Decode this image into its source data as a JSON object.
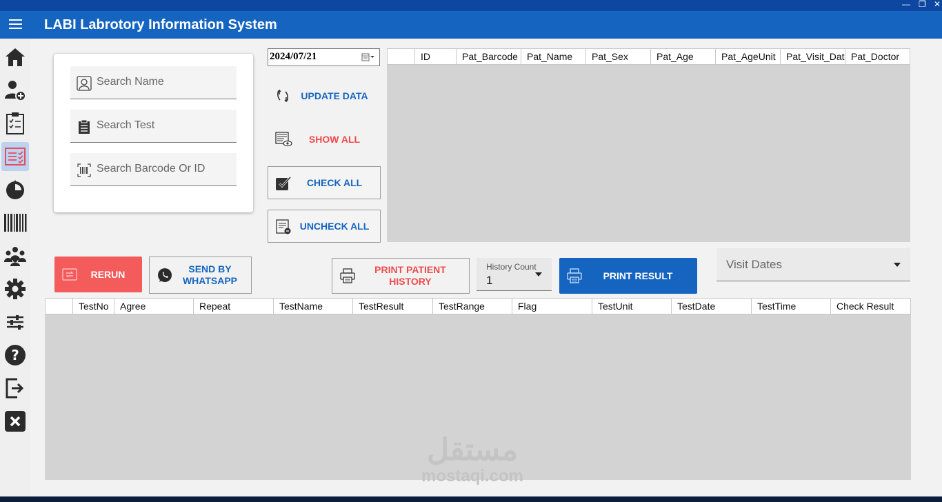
{
  "app": {
    "title": "LABI Labrotory Information System",
    "accent": "#1565c0",
    "danger": "#ef4b4b"
  },
  "window_controls": [
    "minimize-icon",
    "restore-icon",
    "close-icon"
  ],
  "sidebar": {
    "items": [
      {
        "icon": "home-icon"
      },
      {
        "icon": "add-patient-icon"
      },
      {
        "icon": "checklist-icon"
      },
      {
        "icon": "results-list-icon",
        "active": true
      },
      {
        "icon": "pie-icon"
      },
      {
        "icon": "barcode-icon"
      },
      {
        "icon": "users-group-icon"
      },
      {
        "icon": "gear-icon"
      },
      {
        "icon": "sliders-icon"
      },
      {
        "icon": "help-icon"
      },
      {
        "icon": "logout-icon"
      },
      {
        "icon": "close-app-icon"
      }
    ]
  },
  "search": {
    "name_placeholder": "Search Name",
    "test_placeholder": "Search Test",
    "barcode_placeholder": "Search Barcode Or ID"
  },
  "date": {
    "value": "2024/07/21"
  },
  "actions": {
    "update": "UPDATE DATA",
    "show_all": "SHOW ALL",
    "check_all": "CHECK ALL",
    "uncheck_all": "UNCHECK ALL"
  },
  "patients_grid": {
    "columns": [
      "",
      "ID",
      "Pat_Barcode",
      "Pat_Name",
      "Pat_Sex",
      "Pat_Age",
      "Pat_AgeUnit",
      "Pat_Visit_Date",
      "Pat_Doctor"
    ]
  },
  "buttons": {
    "rerun": "RERUN",
    "whatsapp": "SEND BY WHATSAPP",
    "print_history": "PRINT PATIENT HISTORY",
    "print_result": "PRINT RESULT"
  },
  "history_count": {
    "label": "History Count",
    "value": "1"
  },
  "visit_dates": {
    "placeholder": "Visit Dates"
  },
  "tests_grid": {
    "columns": [
      "",
      "TestNo",
      "Agree",
      "Repeat",
      "TestName",
      "TestResult",
      "TestRange",
      "Flag",
      "TestUnit",
      "TestDate",
      "TestTime",
      "Check Result"
    ]
  },
  "watermark": {
    "arabic": "مستقل",
    "latin": "mostaqi.com"
  }
}
